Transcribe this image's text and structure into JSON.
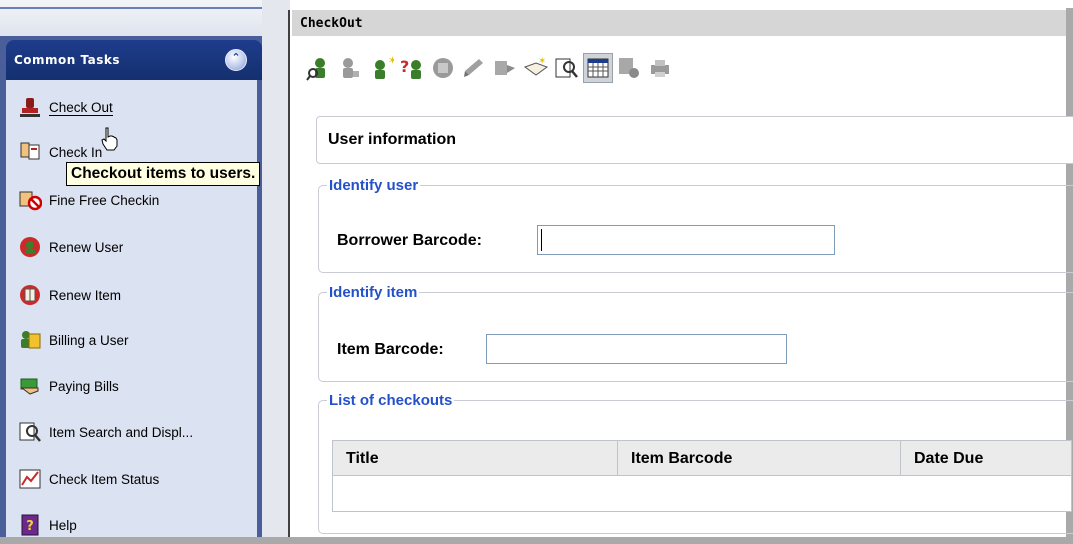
{
  "sidebar": {
    "title": "Common Tasks",
    "collapse_glyph": "⌃",
    "items": [
      {
        "label": "Check Out",
        "icon": "checkout-stamp-icon"
      },
      {
        "label": "Check In",
        "icon": "checkin-hands-icon"
      },
      {
        "label": "Fine Free Checkin",
        "icon": "fine-free-checkin-icon"
      },
      {
        "label": "Renew User",
        "icon": "renew-user-icon"
      },
      {
        "label": "Renew Item",
        "icon": "renew-item-icon"
      },
      {
        "label": "Billing a User",
        "icon": "billing-user-icon"
      },
      {
        "label": "Paying Bills",
        "icon": "paying-bills-icon"
      },
      {
        "label": "Item Search and Displ...",
        "icon": "item-search-icon"
      },
      {
        "label": "Check Item Status",
        "icon": "check-item-status-icon"
      },
      {
        "label": "Help",
        "icon": "help-book-icon"
      }
    ]
  },
  "tooltip": {
    "text": "Checkout items to users."
  },
  "main": {
    "title": "CheckOut",
    "toolbar": [
      "user-search-icon",
      "user-gray-icon",
      "new-user-icon",
      "user-help-icon",
      "gray-disc-icon",
      "gray-pen-icon",
      "gray-hand-icon",
      "book-new-icon",
      "item-search-icon",
      "calendar-icon",
      "gray-gear-icon",
      "gray-printer-icon"
    ],
    "user_info": {
      "title": "User information"
    },
    "identify_user": {
      "legend": "Identify user",
      "label": "Borrower Barcode:",
      "value": ""
    },
    "identify_item": {
      "legend": "Identify item",
      "label": "Item Barcode:",
      "value": ""
    },
    "checkouts": {
      "legend": "List of checkouts",
      "columns": [
        "Title",
        "Item Barcode",
        "Date Due"
      ]
    }
  },
  "colors": {
    "sidebar_bg": "#4a5f9a",
    "panel_bg": "#dbe2f1",
    "legend_blue": "#2451c8",
    "tooltip_bg": "#ffffe1"
  }
}
